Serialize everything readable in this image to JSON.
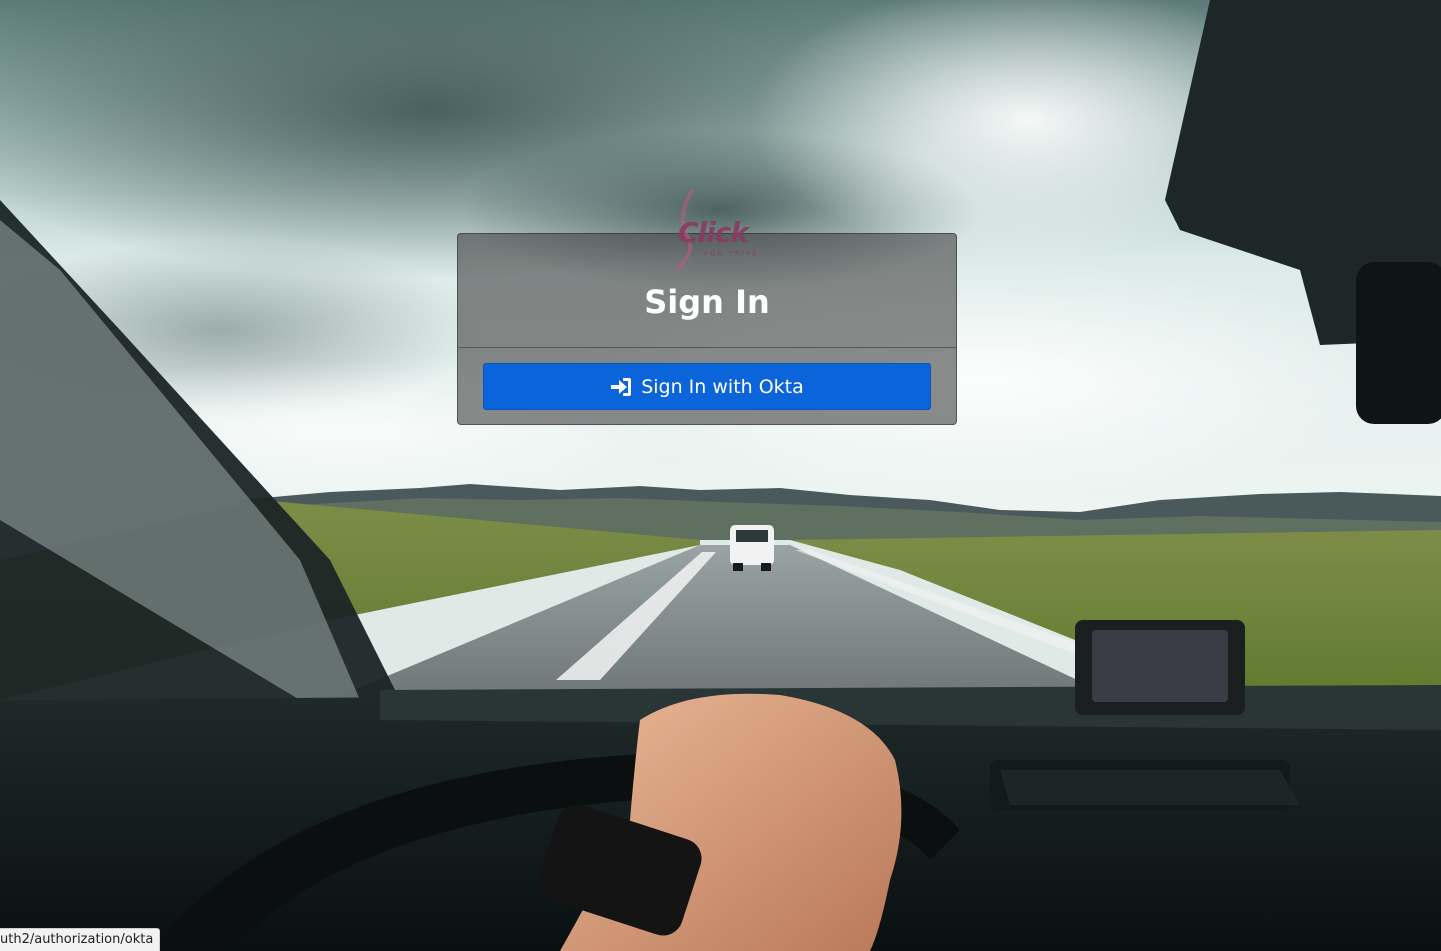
{
  "logo": {
    "word": "Click",
    "subtitle": "FOR TRIPS"
  },
  "signin": {
    "title": "Sign In",
    "okta_button_label": "Sign In with Okta",
    "okta_button_icon": "sign-in-icon",
    "button_color": "#0b64d9"
  },
  "status_bar": {
    "url": "uth2/authorization/okta"
  }
}
